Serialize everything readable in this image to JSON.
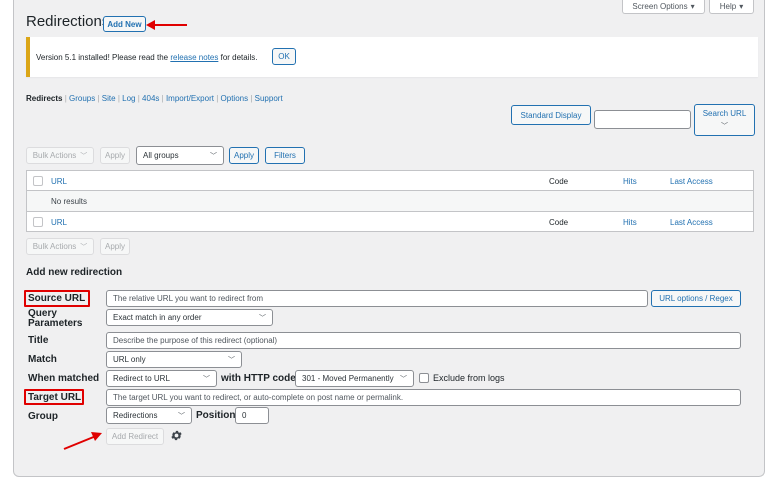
{
  "page": {
    "title": "Redirections",
    "add_new": "Add New",
    "screen_options": "Screen Options",
    "help": "Help"
  },
  "notice": {
    "text_before": "Version 5.1 installed! Please read the",
    "link": "release notes",
    "text_after": "for details.",
    "ok": "OK"
  },
  "subnav": [
    "Redirects",
    "Groups",
    "Site",
    "Log",
    "404s",
    "Import/Export",
    "Options",
    "Support"
  ],
  "search": {
    "standard_display": "Standard Display",
    "search_value": "",
    "search_url": "Search URL"
  },
  "toolbar_top": {
    "bulk_actions": "Bulk Actions",
    "apply": "Apply",
    "groups_select": "All groups",
    "apply2": "Apply",
    "filters": "Filters"
  },
  "table": {
    "columns": [
      "URL",
      "Code",
      "Hits",
      "Last Access"
    ],
    "empty": "No results"
  },
  "toolbar_bottom": {
    "bulk_actions": "Bulk Actions",
    "apply": "Apply"
  },
  "form": {
    "heading": "Add new redirection",
    "source_url_label": "Source URL",
    "source_url_placeholder": "The relative URL you want to redirect from",
    "url_options": "URL options / Regex",
    "query_label": "Query Parameters",
    "query_value": "Exact match in any order",
    "title_label": "Title",
    "title_placeholder": "Describe the purpose of this redirect (optional)",
    "match_label": "Match",
    "match_value": "URL only",
    "when_label": "When matched",
    "when_value": "Redirect to URL",
    "http_label": "with HTTP code",
    "http_value": "301 - Moved Permanently",
    "exclude_label": "Exclude from logs",
    "target_label": "Target URL",
    "target_placeholder": "The target URL you want to redirect, or auto-complete on post name or permalink.",
    "group_label": "Group",
    "group_value": "Redirections",
    "position_label": "Position",
    "position_value": "0",
    "add_redirect": "Add Redirect"
  },
  "colors": {
    "accent": "#2271b1",
    "annotation": "#e00000",
    "notice_border": "#dba617"
  }
}
